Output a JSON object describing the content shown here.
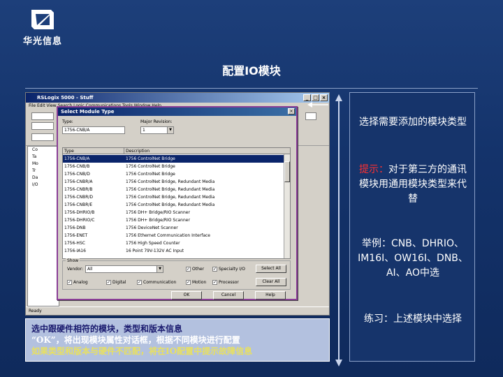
{
  "logo": {
    "text": "华光信息"
  },
  "slide": {
    "title": "配置IO模块"
  },
  "app": {
    "title": "RSLogix 5000 - Stuff",
    "menu": "File  Edit  View  Search  Logic  Communications  Tools  Window  Help",
    "status": "Ready",
    "tree": [
      "Co",
      "Ta",
      "Mo",
      "Tr",
      "Da",
      "I/O"
    ]
  },
  "dialog": {
    "title": "Select Module Type",
    "type_label": "Type:",
    "type_value": "1756-CNB/A",
    "major_label": "Major Revision:",
    "major_value": "1",
    "col_type": "Type",
    "col_desc": "Description",
    "rows": [
      {
        "type": "1756-CNB/A",
        "desc": "1756 ControlNet Bridge",
        "selected": true
      },
      {
        "type": "1756-CNB/B",
        "desc": "1756 ControlNet Bridge",
        "selected": false
      },
      {
        "type": "1756-CNB/D",
        "desc": "1756 ControlNet Bridge",
        "selected": false
      },
      {
        "type": "1756-CNBR/A",
        "desc": "1756 ControlNet Bridge, Redundant Media",
        "selected": false
      },
      {
        "type": "1756-CNBR/B",
        "desc": "1756 ControlNet Bridge, Redundant Media",
        "selected": false
      },
      {
        "type": "1756-CNBR/D",
        "desc": "1756 ControlNet Bridge, Redundant Media",
        "selected": false
      },
      {
        "type": "1756-CNBR/E",
        "desc": "1756 ControlNet Bridge, Redundant Media",
        "selected": false
      },
      {
        "type": "1756-DHRIO/B",
        "desc": "1756 DH+ Bridge/RIO Scanner",
        "selected": false
      },
      {
        "type": "1756-DHRIO/C",
        "desc": "1756 DH+ Bridge/RIO Scanner",
        "selected": false
      },
      {
        "type": "1756-DNB",
        "desc": "1756 DeviceNet Scanner",
        "selected": false
      },
      {
        "type": "1756-ENET",
        "desc": "1756 Ethernet Communication Interface",
        "selected": false
      },
      {
        "type": "1756-HSC",
        "desc": "1756 High Speed Counter",
        "selected": false
      },
      {
        "type": "1756-IA16",
        "desc": "16 Point 79V-132V AC Input",
        "selected": false
      }
    ],
    "show_label": "Show",
    "vendor_label": "Vendor:",
    "vendor_value": "All",
    "checks": {
      "other": "Other",
      "specialty": "Specialty I/O",
      "analog": "Analog",
      "digital": "Digital",
      "communication": "Communication",
      "motion": "Motion",
      "processor": "Processor"
    },
    "buttons": {
      "select_all": "Select All",
      "clear_all": "Clear All",
      "ok": "OK",
      "cancel": "Cancel",
      "help": "Help"
    }
  },
  "caption": {
    "line1": "选中跟硬件相符的模块，类型和版本信息",
    "line2": "“OK”，将出现模块属性对话框，根据不同模块进行配置",
    "line3": "如果类型和版本与硬件不匹配，将在IO配置中提示故障信息"
  },
  "panel": {
    "p1": "选择需要添加的模块类型",
    "p2_label": "提示：",
    "p2_text": "对于第三方的通讯模块用通用模块类型来代替",
    "p3": "举例：CNB、DHRIO、IM16I、OW16I、DNB、AI、AO中选",
    "p4": "练习：上述模块中选择"
  },
  "colors": {
    "background": "#14336b",
    "caption_bg": "#b3c1df",
    "caption_line1": "#1a1a6e",
    "caption_line3": "#e8e060",
    "hint_red": "#ff3030",
    "dialog_border": "#8a3d96"
  }
}
